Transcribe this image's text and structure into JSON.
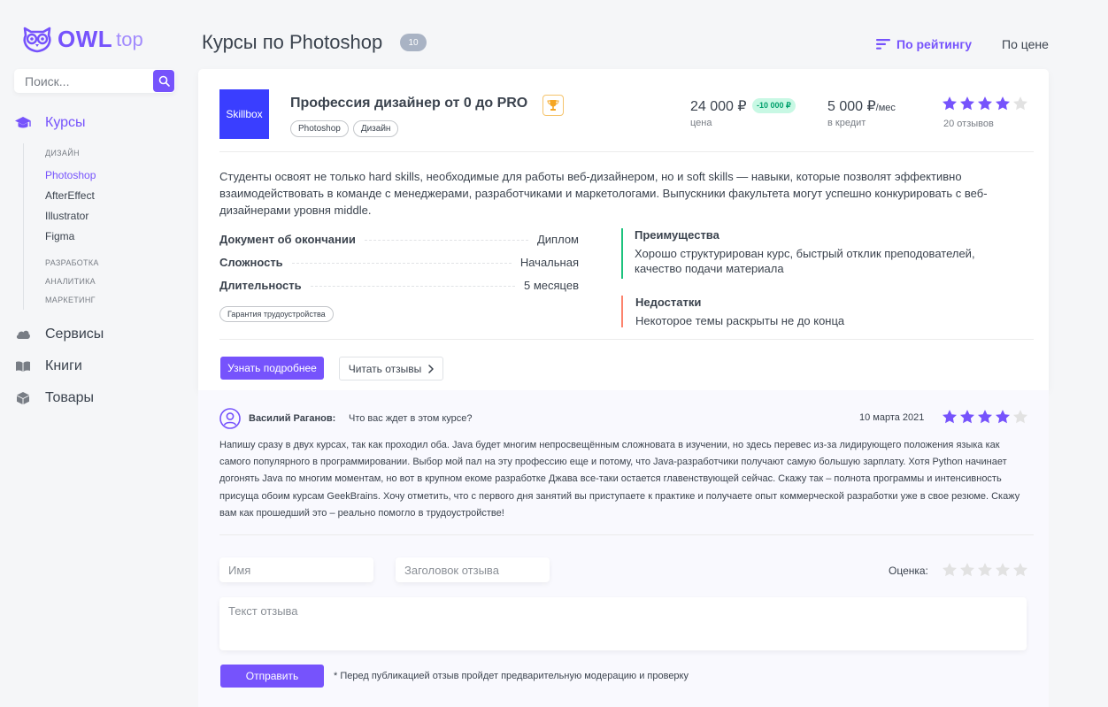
{
  "brand": {
    "owl": "OWL",
    "top": "top"
  },
  "search": {
    "placeholder": "Поиск..."
  },
  "menu": {
    "courses": "Курсы",
    "categories": {
      "design": "ДИЗАЙН",
      "dev": "РАЗРАБОТКА",
      "analytics": "АНАЛИТИКА",
      "marketing": "МАРКЕТИНГ"
    },
    "design_items": [
      "Photoshop",
      "AfterEffect",
      "Illustrator",
      "Figma"
    ],
    "services": "Сервисы",
    "books": "Книги",
    "goods": "Товары"
  },
  "header": {
    "title": "Курсы по Photoshop",
    "count": "10",
    "sort_rating": "По рейтингу",
    "sort_price": "По цене"
  },
  "course": {
    "logo": "Skillbox",
    "title": "Профессия дизайнер от 0 до PRO",
    "tags": [
      "Photoshop",
      "Дизайн"
    ],
    "price": "24 000 ₽",
    "discount": "-10 000 ₽",
    "price_label": "цена",
    "credit": "5 000 ₽",
    "credit_unit": "/мес",
    "credit_label": "в кредит",
    "rating": 4,
    "reviews_count": "20 отзывов",
    "description": "Студенты освоят не только hard skills, необходимые для работы веб-дизайнером, но и soft skills — навыки, которые позволят эффективно взаимодействовать в команде с менеджерами, разработчиками и маркетологами. Выпускники факультета могут успешно конкурировать с веб-дизайнерами уровня middle.",
    "features": [
      {
        "k": "Документ об окончании",
        "v": "Диплом"
      },
      {
        "k": "Сложность",
        "v": "Начальная"
      },
      {
        "k": "Длительность",
        "v": "5 месяцев"
      }
    ],
    "guarantee": "Гарантия трудоустройства",
    "advantages_title": "Преимущества",
    "advantages": "Хорошо структурирован курс, быстрый отклик преподователей, качество подачи материала",
    "disadvantages_title": "Недостатки",
    "disadvantages": "Некоторое темы раскрыты не до конца",
    "more_button": "Узнать подробнее",
    "reviews_button": "Читать отзывы"
  },
  "review": {
    "author": "Василий Раганов:",
    "title": "Что вас ждет в этом курсе?",
    "date": "10 марта 2021",
    "rating": 4,
    "text": "Напишу сразу в двух курсах, так как проходил оба. Java будет многим непросвещённым сложновата в изучении, но здесь перевес из-за лидирующего положения языка как самого популярного в программировании. Выбор мой пал на эту профессию еще и потому, что Java-разработчики получают самую большую зарплату. Хотя Python начинает догонять Java по многим моментам, но вот в крупном екоме разработке Джава все-таки остается главенствующей сейчас. Скажу так – полнота программы и интенсивность присуща обоим курсам GeekBrains. Хочу отметить, что с первого дня занятий вы приступаете к практике и получаете опыт коммерческой разработки уже в свое резюме. Скажу вам как прошедший это – реально помогло в трудоустройстве!"
  },
  "form": {
    "name_placeholder": "Имя",
    "title_placeholder": "Заголовок отзыва",
    "rating_label": "Оценка:",
    "rating": 0,
    "text_placeholder": "Текст отзыва",
    "submit": "Отправить",
    "note": "* Перед публикацией отзыв пройдет предварительную модерацию и проверку"
  },
  "colors": {
    "accent": "#7653fc",
    "green": "#1dc37e",
    "red": "#fc836d",
    "star_empty": "#e2e2e2"
  }
}
